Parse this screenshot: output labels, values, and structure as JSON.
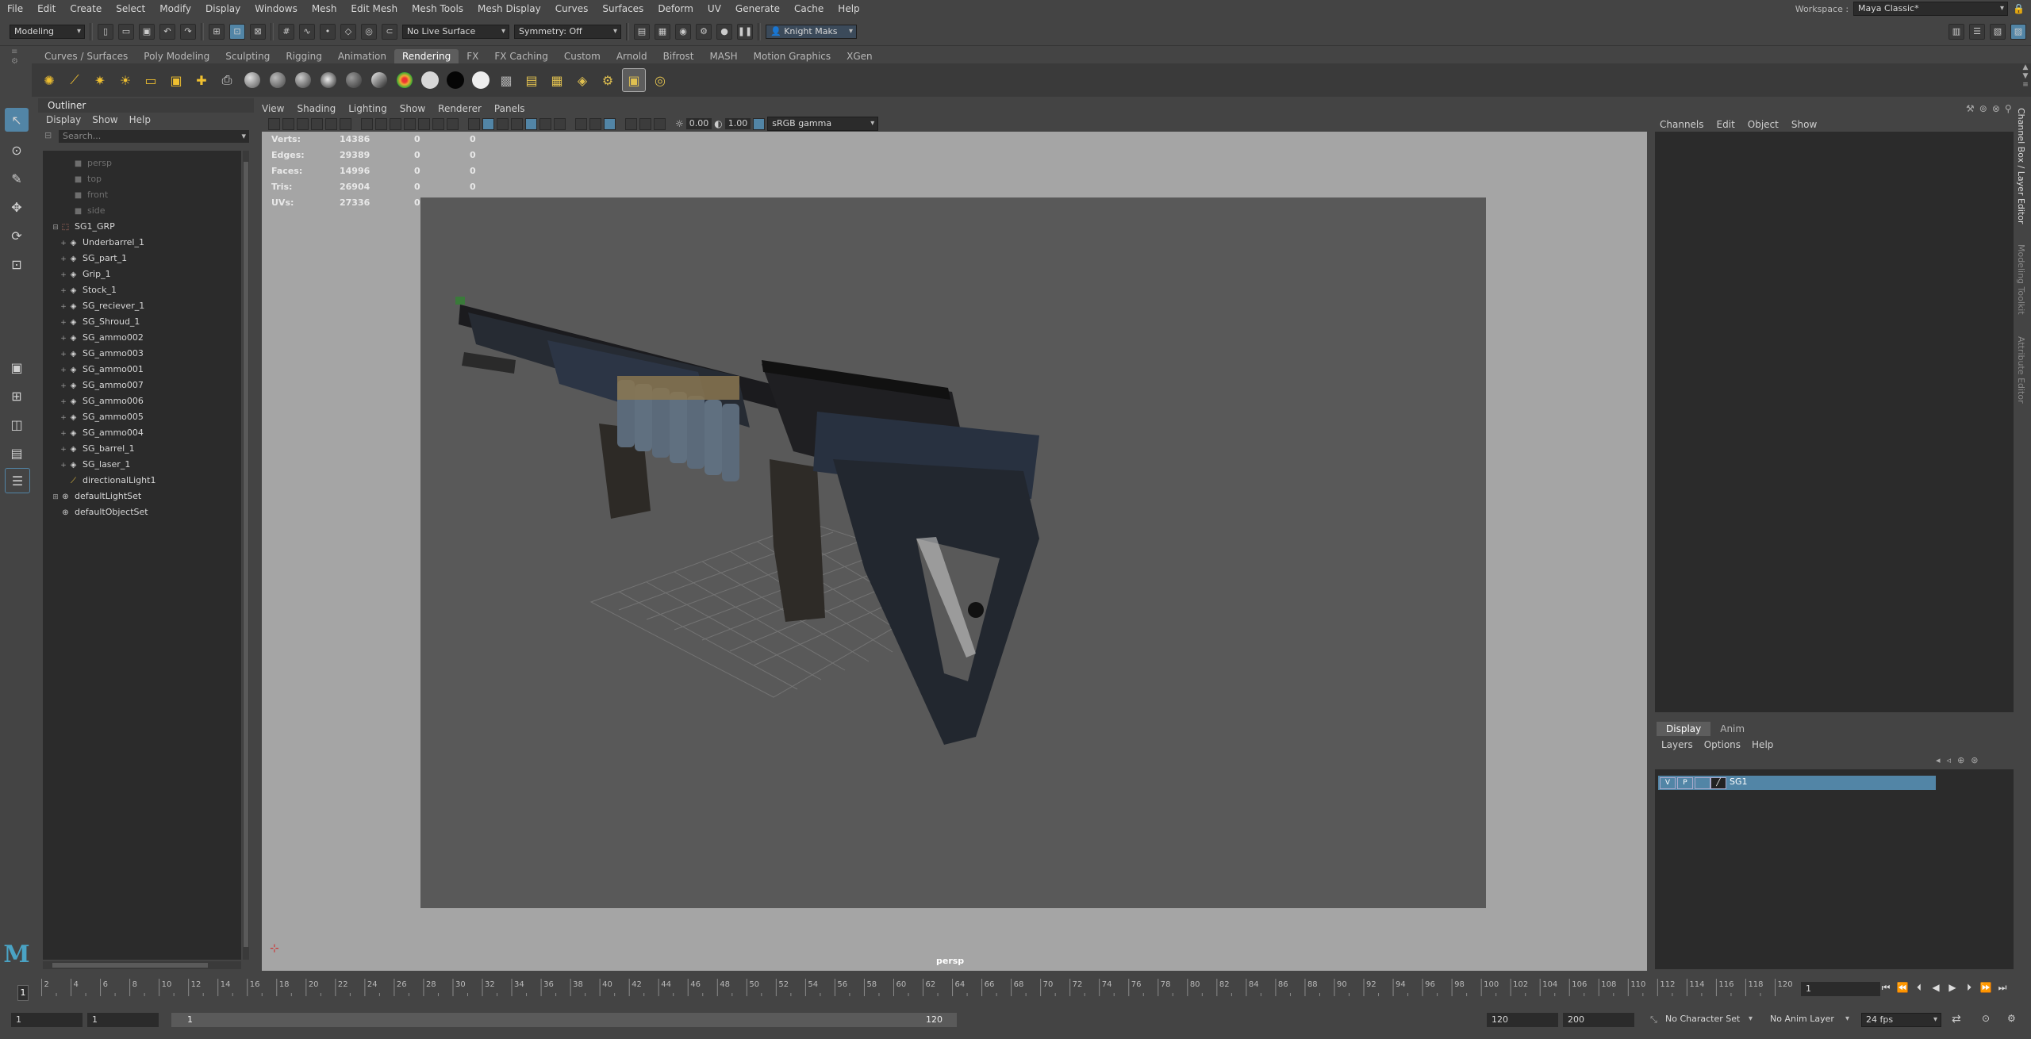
{
  "menubar": {
    "items": [
      "File",
      "Edit",
      "Create",
      "Select",
      "Modify",
      "Display",
      "Windows",
      "Mesh",
      "Edit Mesh",
      "Mesh Tools",
      "Mesh Display",
      "Curves",
      "Surfaces",
      "Deform",
      "UV",
      "Generate",
      "Cache",
      "Help"
    ],
    "workspace_label": "Workspace :",
    "workspace_value": "Maya Classic*"
  },
  "statusline": {
    "menuset": "Modeling",
    "live_surface": "No Live Surface",
    "symmetry": "Symmetry: Off",
    "user": "Knight Maks"
  },
  "shelf": {
    "tabs": [
      "Curves / Surfaces",
      "Poly Modeling",
      "Sculpting",
      "Rigging",
      "Animation",
      "Rendering",
      "FX",
      "FX Caching",
      "Custom",
      "Arnold",
      "Bifrost",
      "MASH",
      "Motion Graphics",
      "XGen"
    ],
    "active_tab": "Rendering"
  },
  "outliner": {
    "title": "Outliner",
    "menu": [
      "Display",
      "Show",
      "Help"
    ],
    "search_placeholder": "Search...",
    "cameras": [
      "persp",
      "top",
      "front",
      "side"
    ],
    "group": "SG1_GRP",
    "children": [
      "Underbarrel_1",
      "SG_part_1",
      "Grip_1",
      "Stock_1",
      "SG_reciever_1",
      "SG_Shroud_1",
      "SG_ammo002",
      "SG_ammo003",
      "SG_ammo001",
      "SG_ammo007",
      "SG_ammo006",
      "SG_ammo005",
      "SG_ammo004",
      "SG_barrel_1",
      "SG_laser_1"
    ],
    "others": [
      "directionalLight1",
      "defaultLightSet",
      "defaultObjectSet"
    ]
  },
  "viewport": {
    "menu": [
      "View",
      "Shading",
      "Lighting",
      "Show",
      "Renderer",
      "Panels"
    ],
    "exposure": "0.00",
    "gamma": "1.00",
    "color_space": "sRGB gamma",
    "camera_label": "persp",
    "hud": [
      {
        "label": "Verts:",
        "value": "14386",
        "sel": "0",
        "comp": "0"
      },
      {
        "label": "Edges:",
        "value": "29389",
        "sel": "0",
        "comp": "0"
      },
      {
        "label": "Faces:",
        "value": "14996",
        "sel": "0",
        "comp": "0"
      },
      {
        "label": "Tris:",
        "value": "26904",
        "sel": "0",
        "comp": "0"
      },
      {
        "label": "UVs:",
        "value": "27336",
        "sel": "0",
        "comp": "0"
      }
    ]
  },
  "channelbox": {
    "menu": [
      "Channels",
      "Edit",
      "Object",
      "Show"
    ],
    "side_tabs": [
      "Channel Box / Layer Editor",
      "Modeling Toolkit",
      "Attribute Editor"
    ]
  },
  "layers": {
    "tabs": [
      "Display",
      "Anim"
    ],
    "active_tab": "Display",
    "menu": [
      "Layers",
      "Options",
      "Help"
    ],
    "layer": {
      "v": "V",
      "p": "P",
      "name": "SG1"
    }
  },
  "timeline": {
    "ticks": [
      "2",
      "4",
      "6",
      "8",
      "10",
      "12",
      "14",
      "16",
      "18",
      "20",
      "22",
      "24",
      "26",
      "28",
      "30",
      "32",
      "34",
      "36",
      "38",
      "40",
      "42",
      "44",
      "46",
      "48",
      "50",
      "52",
      "54",
      "56",
      "58",
      "60",
      "62",
      "64",
      "66",
      "68",
      "70",
      "72",
      "74",
      "76",
      "78",
      "80",
      "82",
      "84",
      "86",
      "88",
      "90",
      "92",
      "94",
      "96",
      "98",
      "100",
      "102",
      "104",
      "106",
      "108",
      "110",
      "112",
      "114",
      "116",
      "118",
      "120"
    ],
    "current_frame_marker": "1",
    "current_frame_field": "1",
    "start": "1",
    "start2": "1",
    "range_start": "1",
    "range_end": "120",
    "end": "120",
    "end2": "200",
    "character_set": "No Character Set",
    "anim_layer": "No Anim Layer",
    "fps": "24 fps"
  },
  "colors": {
    "accent": "#5285a6",
    "panel": "#444444",
    "dark": "#2b2b2b",
    "viewport_bg": "#a5a5a5",
    "gate": "#595959"
  }
}
